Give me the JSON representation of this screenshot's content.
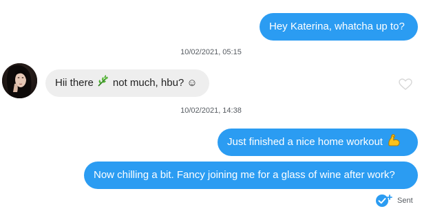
{
  "colors": {
    "outgoing_bubble": "#2b9cf2",
    "incoming_bubble": "#eeeeee",
    "timestamp_text": "#555a60"
  },
  "messages": [
    {
      "direction": "outgoing",
      "text": "Hey Katerina, whatcha up to?"
    },
    {
      "direction": "incoming",
      "text_before": "Hii there",
      "emoji": "herb-icon",
      "text_after": "not much, hbu? ☺"
    },
    {
      "direction": "outgoing",
      "text": "Just finished a nice home workout",
      "emoji": "flexed-biceps-icon"
    },
    {
      "direction": "outgoing",
      "text": "Now chilling a bit. Fancy joining me for a glass of wine after work?"
    }
  ],
  "timestamps": [
    "10/02/2021, 05:15",
    "10/02/2021, 14:38"
  ],
  "like_icon": "heart-outline-icon",
  "status": {
    "icon": "sent-check-icon",
    "label": "Sent"
  }
}
